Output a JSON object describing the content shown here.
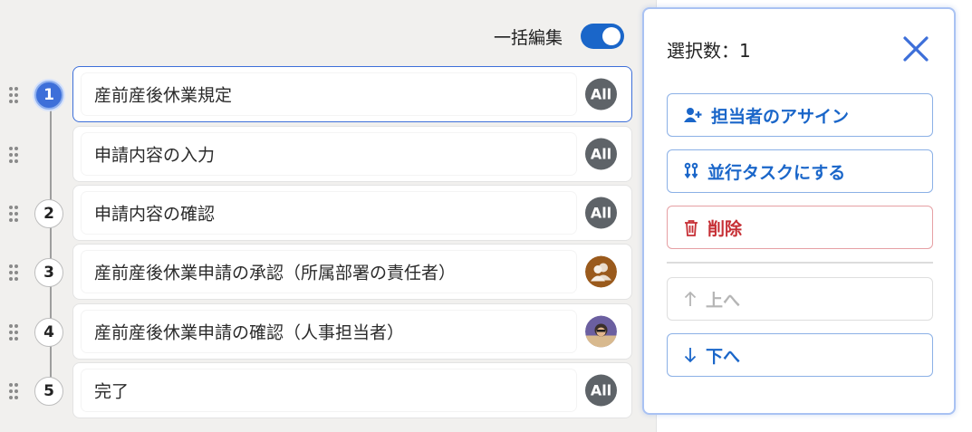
{
  "bulk_edit": {
    "label": "一括編集",
    "enabled": true
  },
  "steps": [
    {
      "number": "1",
      "title": "産前産後休業規定",
      "assignee": "All",
      "assignee_type": "all-badge",
      "selected": true
    },
    {
      "number": "",
      "title": "申請内容の入力",
      "assignee": "All",
      "assignee_type": "all-badge",
      "selected": false
    },
    {
      "number": "2",
      "title": "申請内容の確認",
      "assignee": "All",
      "assignee_type": "all-badge",
      "selected": false
    },
    {
      "number": "3",
      "title": "産前産後休業申請の承認（所属部署の責任者）",
      "assignee": "",
      "assignee_type": "group-avatar",
      "selected": false
    },
    {
      "number": "4",
      "title": "産前産後休業申請の確認（人事担当者）",
      "assignee": "",
      "assignee_type": "photo-avatar",
      "selected": false
    },
    {
      "number": "5",
      "title": "完了",
      "assignee": "All",
      "assignee_type": "all-badge",
      "selected": false
    }
  ],
  "panel": {
    "title": "選択数：1",
    "actions": {
      "assign": {
        "label": "担当者のアサイン",
        "icon": "user-plus-icon"
      },
      "parallel": {
        "label": "並行タスクにする",
        "icon": "parallel-icon"
      },
      "delete": {
        "label": "削除",
        "icon": "trash-icon"
      },
      "up": {
        "label": "上へ",
        "icon": "arrow-up-icon",
        "disabled": true
      },
      "down": {
        "label": "下へ",
        "icon": "arrow-down-icon",
        "disabled": false
      }
    }
  },
  "colors": {
    "accent": "#1a66c9",
    "selection": "#3d6fd9",
    "danger": "#c62f35",
    "badge": "#5e6368"
  }
}
